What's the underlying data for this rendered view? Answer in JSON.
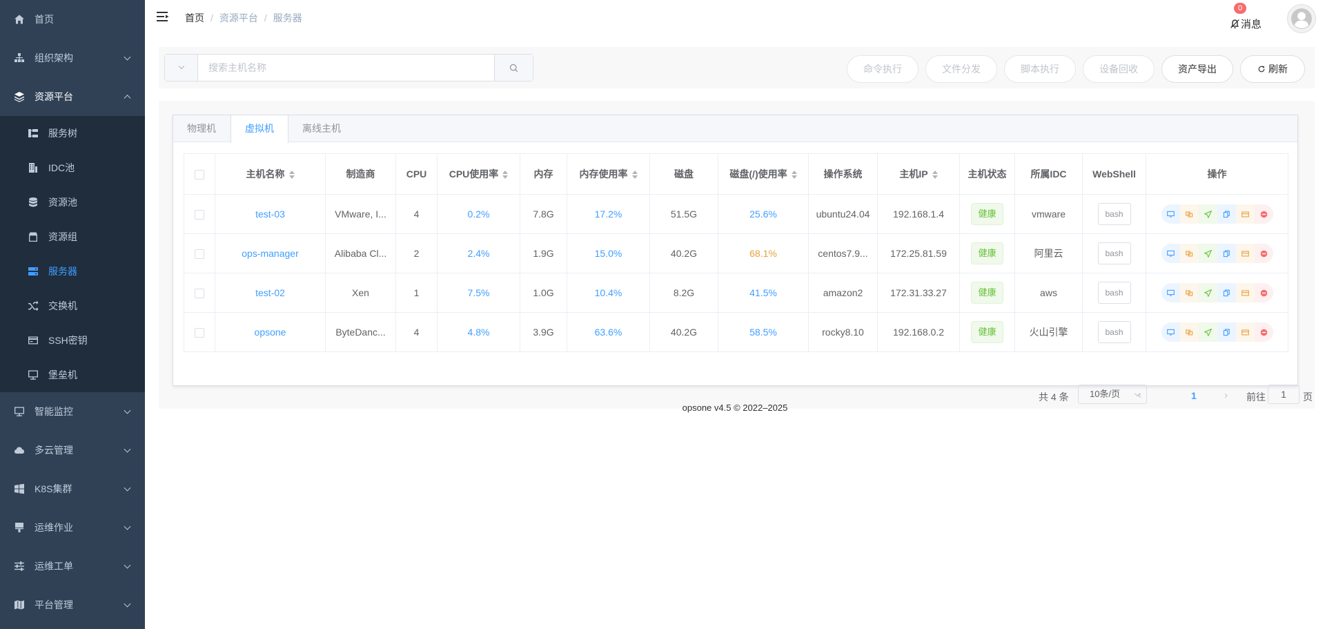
{
  "sidebar": {
    "items": [
      {
        "label": "首页",
        "icon": "home-icon"
      },
      {
        "label": "组织架构",
        "icon": "org-icon"
      },
      {
        "label": "资源平台",
        "icon": "layers-icon"
      }
    ],
    "sub_items": [
      {
        "label": "服务树",
        "icon": "tree-icon"
      },
      {
        "label": "IDC池",
        "icon": "building-icon"
      },
      {
        "label": "资源池",
        "icon": "database-icon"
      },
      {
        "label": "资源组",
        "icon": "box-icon"
      },
      {
        "label": "服务器",
        "icon": "server-icon"
      },
      {
        "label": "交换机",
        "icon": "shuffle-icon"
      },
      {
        "label": "SSH密钥",
        "icon": "card-icon"
      },
      {
        "label": "堡垒机",
        "icon": "monitor-icon"
      }
    ],
    "items_after": [
      {
        "label": "智能监控",
        "icon": "monitor-icon"
      },
      {
        "label": "多云管理",
        "icon": "cloud-icon"
      },
      {
        "label": "K8S集群",
        "icon": "windows-icon"
      },
      {
        "label": "运维作业",
        "icon": "brush-icon"
      },
      {
        "label": "运维工单",
        "icon": "sliders-icon"
      },
      {
        "label": "平台管理",
        "icon": "map-icon"
      }
    ]
  },
  "header": {
    "breadcrumb": [
      "首页",
      "资源平台",
      "服务器"
    ],
    "notice_label": "消息",
    "notice_count": "0"
  },
  "search": {
    "placeholder": "搜索主机名称"
  },
  "toolbar": {
    "cmd_exec": "命令执行",
    "file_dist": "文件分发",
    "script_exec": "脚本执行",
    "recycle": "设备回收",
    "export": "资产导出",
    "refresh": "刷新"
  },
  "tabs": [
    "物理机",
    "虚拟机",
    "离线主机"
  ],
  "table": {
    "columns": [
      "主机名称",
      "制造商",
      "CPU",
      "CPU使用率",
      "内存",
      "内存使用率",
      "磁盘",
      "磁盘(/)使用率",
      "操作系统",
      "主机IP",
      "主机状态",
      "所属IDC",
      "WebShell",
      "操作"
    ],
    "rows": [
      {
        "name": "test-03",
        "vendor": "VMware, I...",
        "cpu": "4",
        "cpu_usage": "0.2%",
        "mem": "7.8G",
        "mem_usage": "17.2%",
        "disk": "51.5G",
        "disk_usage": "25.6%",
        "os": "ubuntu24.04",
        "ip": "192.168.1.4",
        "status": "健康",
        "idc": "vmware",
        "webshell": "bash"
      },
      {
        "name": "ops-manager",
        "vendor": "Alibaba Cl...",
        "cpu": "2",
        "cpu_usage": "2.4%",
        "mem": "1.9G",
        "mem_usage": "15.0%",
        "disk": "40.2G",
        "disk_usage": "68.1%",
        "os": "centos7.9...",
        "ip": "172.25.81.59",
        "status": "健康",
        "idc": "阿里云",
        "webshell": "bash"
      },
      {
        "name": "test-02",
        "vendor": "Xen",
        "cpu": "1",
        "cpu_usage": "7.5%",
        "mem": "1.0G",
        "mem_usage": "10.4%",
        "disk": "8.2G",
        "disk_usage": "41.5%",
        "os": "amazon2",
        "ip": "172.31.33.27",
        "status": "健康",
        "idc": "aws",
        "webshell": "bash"
      },
      {
        "name": "opsone",
        "vendor": "ByteDanc...",
        "cpu": "4",
        "cpu_usage": "4.8%",
        "mem": "3.9G",
        "mem_usage": "63.6%",
        "disk": "40.2G",
        "disk_usage": "58.5%",
        "os": "rocky8.10",
        "ip": "192.168.0.2",
        "status": "健康",
        "idc": "火山引擎",
        "webshell": "bash"
      }
    ]
  },
  "pagination": {
    "total": "共 4 条",
    "page_size": "10条/页",
    "current": "1",
    "goto_label": "前往",
    "goto_value": "1",
    "page_suffix": "页"
  },
  "footer": "opsone v4.5 © 2022–2025",
  "colors": {
    "sidebar_bg": "#304156",
    "submenu_bg": "#1f2d3d",
    "accent": "#409eff",
    "warning": "#e6a23c",
    "success": "#67c23a",
    "danger": "#f56c6c"
  }
}
